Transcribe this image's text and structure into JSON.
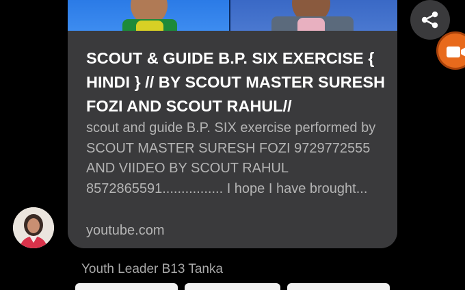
{
  "link_preview": {
    "title": "SCOUT & GUIDE B.P. SIX EXERCISE { HINDI } // BY SCOUT MASTER SURESH FOZI AND SCOUT RAHUL//",
    "description": "scout and guide B.P. SIX exercise performed by SCOUT MASTER SURESH FOZI 9729772555 AND VIIDEO BY SCOUT RAHUL 8572865591................ I hope I have brought...",
    "domain": "youtube.com"
  },
  "message": {
    "sender": "Youth Leader B13 Tanka"
  },
  "icons": {
    "share": "share-icon",
    "record": "video-camera-icon"
  },
  "colors": {
    "background": "#000000",
    "card": "#3a3a3c",
    "title_text": "#ffffff",
    "secondary_text": "#b4b4b4",
    "record_button": "#e86a1c"
  }
}
